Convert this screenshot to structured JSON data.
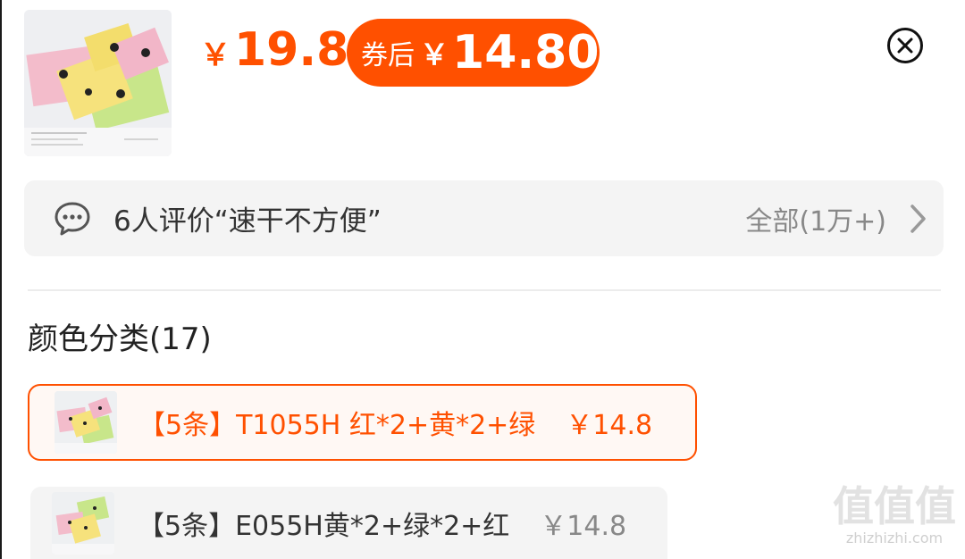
{
  "header": {
    "price_currency": "￥",
    "price": "19.8",
    "coupon_label": "券后",
    "coupon_currency": "￥",
    "coupon_price": "14.80",
    "close_icon": "close-circle-icon"
  },
  "product_image": {
    "caption_line1": "COMFORTS ? PHOTO/FLUID",
    "caption_line2": "规格：34*72cm",
    "caption_line3": "颜色：红黄绿",
    "caption_brand": "TO855 纯棉毛巾"
  },
  "reviews": {
    "icon": "chat-bubble-icon",
    "text": "6人评价“速干不方便”",
    "all_label": "全部(1万+)",
    "chevron_icon": "chevron-right-icon"
  },
  "color_section": {
    "title": "颜色分类(17)",
    "options": [
      {
        "name": "【5条】T1055H 红*2+黄*2+绿",
        "price": "￥14.8",
        "selected": true
      },
      {
        "name": "【5条】E055H黄*2+绿*2+红",
        "price": "￥14.8",
        "selected": false
      }
    ]
  },
  "watermark": {
    "logo": "值值值",
    "url": "zhizhizhi.com"
  },
  "colors": {
    "accent": "#ff5000",
    "towel_pink": "#f2b8c8",
    "towel_yellow": "#f5e27a",
    "towel_green": "#c5e686",
    "review_bg": "#f4f4f4"
  }
}
